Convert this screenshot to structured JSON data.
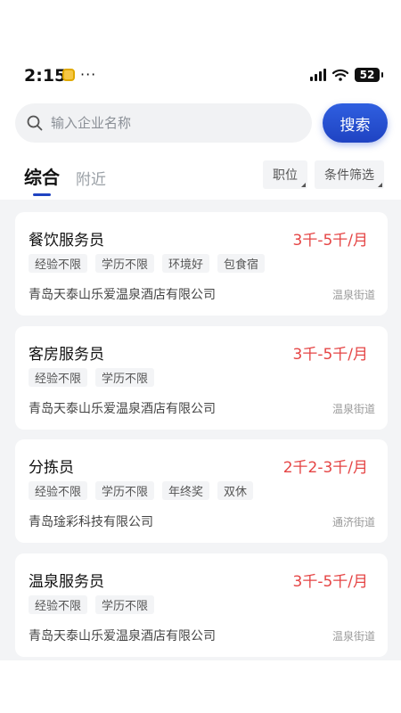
{
  "status": {
    "time": "2:15",
    "dots": "···",
    "battery": "52"
  },
  "search": {
    "placeholder": "输入企业名称",
    "button_label": "搜索"
  },
  "tabs": [
    {
      "label": "综合",
      "active": true
    },
    {
      "label": "附近",
      "active": false
    }
  ],
  "filters": [
    {
      "label": "职位"
    },
    {
      "label": "条件筛选"
    }
  ],
  "jobs": [
    {
      "title": "餐饮服务员",
      "salary": "3千-5千/月",
      "tags": [
        "经验不限",
        "学历不限",
        "环境好",
        "包食宿"
      ],
      "company": "青岛天泰山乐爱温泉酒店有限公司",
      "location": "温泉街道"
    },
    {
      "title": "客房服务员",
      "salary": "3千-5千/月",
      "tags": [
        "经验不限",
        "学历不限"
      ],
      "company": "青岛天泰山乐爱温泉酒店有限公司",
      "location": "温泉街道"
    },
    {
      "title": "分拣员",
      "salary": "2千2-3千/月",
      "tags": [
        "经验不限",
        "学历不限",
        "年终奖",
        "双休"
      ],
      "company": "青岛琻彩科技有限公司",
      "location": "通济街道"
    },
    {
      "title": "温泉服务员",
      "salary": "3千-5千/月",
      "tags": [
        "经验不限",
        "学历不限"
      ],
      "company": "青岛天泰山乐爱温泉酒店有限公司",
      "location": "温泉街道"
    }
  ],
  "colors": {
    "accent": "#1f43c2",
    "salary": "#e54545",
    "list_background": "#f3f4f6"
  }
}
